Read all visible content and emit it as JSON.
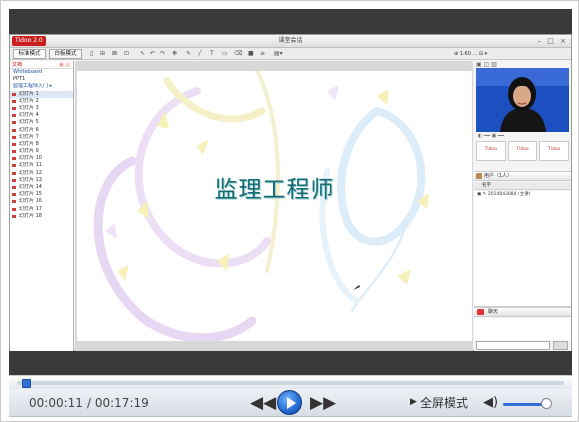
{
  "app": {
    "logo_text": "Tidoo 2.0",
    "window_title": "课堂会话",
    "window_controls": "– □ ×"
  },
  "toolbar": {
    "mode_tab_1": "标准模式",
    "mode_tab_2": "白板模式",
    "status_text": "⊕ 1.60 ... ⊟ ▾"
  },
  "left_panel": {
    "header": "文档",
    "items": [
      {
        "label": "Whiteboard",
        "type": "hdr"
      },
      {
        "label": "PPT1",
        "type": "file"
      },
      {
        "label": "监理工程师入门 ▸",
        "type": "hdr"
      },
      {
        "label": "幻灯片 1",
        "type": "slide",
        "selected": true
      },
      {
        "label": "幻灯片 2",
        "type": "slide"
      },
      {
        "label": "幻灯片 3",
        "type": "slide"
      },
      {
        "label": "幻灯片 4",
        "type": "slide"
      },
      {
        "label": "幻灯片 5",
        "type": "slide"
      },
      {
        "label": "幻灯片 6",
        "type": "slide"
      },
      {
        "label": "幻灯片 7",
        "type": "slide"
      },
      {
        "label": "幻灯片 8",
        "type": "slide"
      },
      {
        "label": "幻灯片 9",
        "type": "slide"
      },
      {
        "label": "幻灯片 10",
        "type": "slide"
      },
      {
        "label": "幻灯片 11",
        "type": "slide"
      },
      {
        "label": "幻灯片 12",
        "type": "slide"
      },
      {
        "label": "幻灯片 13",
        "type": "slide"
      },
      {
        "label": "幻灯片 14",
        "type": "slide"
      },
      {
        "label": "幻灯片 15",
        "type": "slide"
      },
      {
        "label": "幻灯片 16",
        "type": "slide"
      },
      {
        "label": "幻灯片 17",
        "type": "slide"
      },
      {
        "label": "幻灯片 18",
        "type": "slide"
      }
    ]
  },
  "slide": {
    "title": "监理工程师"
  },
  "right_panel": {
    "icons_row": "▣ ◫ ▥",
    "video_controls": "◐ ━━ ▣ ━━",
    "logos": [
      "Tidoo",
      "Tidoo",
      "Tidoo"
    ],
    "users_header": "用户（1人）",
    "users_columns": "名字",
    "user_entry": "▣ ✎ 2014043084 (主讲)",
    "chat_header": "聊天"
  },
  "player": {
    "time_current": "00:00:11",
    "time_total": "/ 00:17:19",
    "progress": 0.01,
    "fullscreen_label": "全屏模式",
    "volume": 0.8,
    "colors": {
      "accent": "#2f6fd6",
      "band": "#3a3a3a"
    }
  }
}
